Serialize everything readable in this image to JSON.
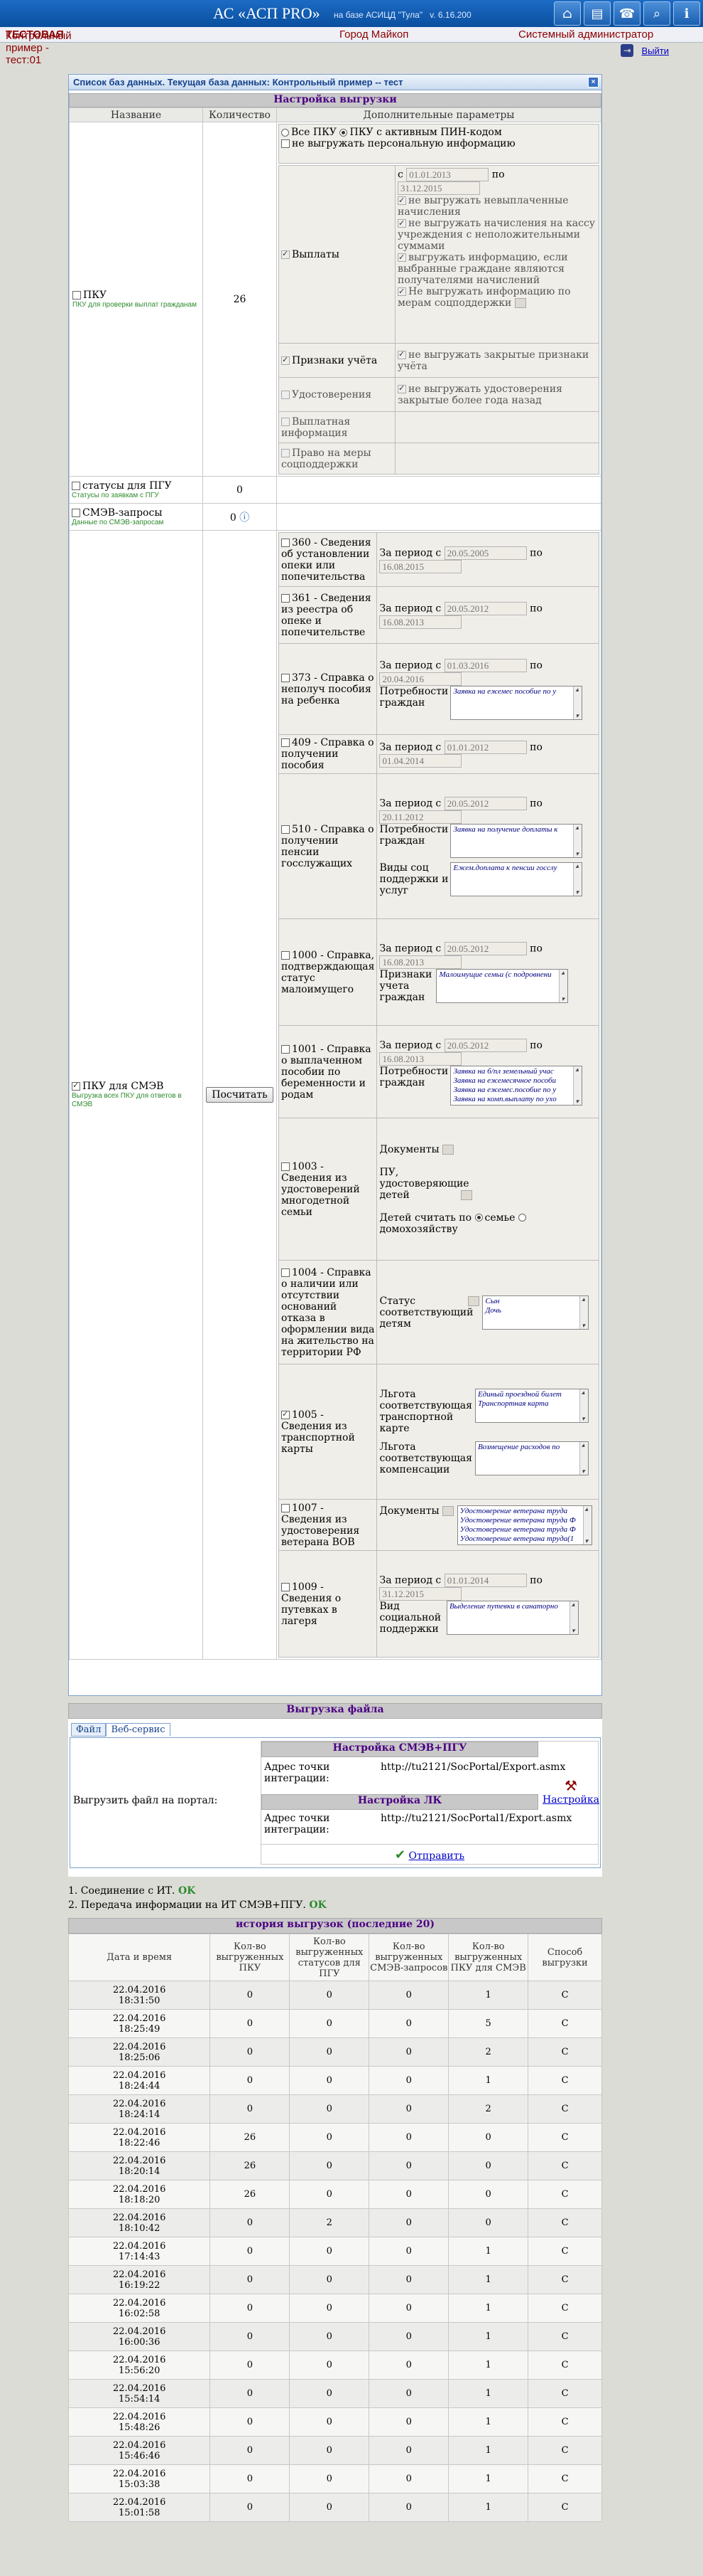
{
  "header": {
    "app_title": "АС «АСП PRO»",
    "base_label": "на базе АСИЦД \"Тула\"",
    "version": "v. 6.16.200",
    "test_label": "Контрольный пример - тест:01",
    "test_badge": "ТЕСТОВАЯ",
    "city": "Город Майкоп",
    "user": "Системный администратор",
    "exit": "Выйти",
    "icons": [
      "home-icon",
      "document-icon",
      "phone-icon",
      "search-icon",
      "info-icon"
    ]
  },
  "db_panel": {
    "title": "Список баз данных. Текущая база данных: Контрольный пример -- тест"
  },
  "export_settings": {
    "title": "Настройка выгрузки",
    "columns": [
      "Название",
      "Количество",
      "Дополнительные параметры"
    ],
    "pku": {
      "name": "ПКУ",
      "hint": "ПКУ для проверки выплат гражданам",
      "count": "26",
      "radio_all": "Все ПКУ",
      "radio_pin": "ПКУ с активным ПИН-кодом",
      "no_personal": "не выгружать персональную информацию",
      "payments": "Выплаты",
      "from": "с",
      "to": "по",
      "date_from": "01.01.2013",
      "date_to": "31.12.2015",
      "opt1": "не выгружать невыплаченные начисления",
      "opt2": "не выгружать начисления на кассу учреждения с неположительными суммами",
      "opt3": "выгружать информацию, если выбранные граждане являются получателями начислений",
      "opt4": "Не выгружать информацию по мерам соцподдержки",
      "signs": "Признаки учёта",
      "signs_opt": "не выгружать закрытые признаки учёта",
      "ids": "Удостоверения",
      "ids_opt": "не выгружать удостоверения закрытые более года назад",
      "paid_info": "Выплатная информация",
      "right_measures": "Право на меры соцподдержки"
    },
    "pgu": {
      "name": "статусы для ПГУ",
      "hint": "Статусы по заявкам с ПГУ",
      "count": "0"
    },
    "smev_req": {
      "name": "СМЭВ-запросы",
      "hint": "Данные по СМЭВ-запросам",
      "count": "0"
    },
    "smev": {
      "name": "ПКУ для СМЭВ",
      "hint": "Выгрузка всех ПКУ для ответов в СМЭВ",
      "button": "Посчитать",
      "period_prefix": "За период с",
      "to": "по",
      "need_label": "Потребности граждан",
      "measures_label": "Виды соц поддержки и услуг",
      "signs_label": "Признаки учета граждан",
      "documents_label": "Документы",
      "pu_label": "ПУ, удостоверяющие детей",
      "count_children": "Детей считать по",
      "by_family": "семье",
      "by_household": "домохозяйству",
      "status_children": "Статус соответствующий детям",
      "benefit_card": "Льгота соответствующая транспортной карте",
      "benefit_comp": "Льгота соответствующая компенсации",
      "rest_type": "Вид социальной поддержки",
      "requests": [
        {
          "code": "360",
          "label": "360 - Сведения об установлении опеки или попечительства",
          "d1": "20.05.2005",
          "d2": "16.08.2015"
        },
        {
          "code": "361",
          "label": "361 - Сведения из реестра об опеке и попечительстве",
          "d1": "20.05.2012",
          "d2": "16.08.2013"
        },
        {
          "code": "373",
          "label": "373 - Справка о неполуч пособия на ребенка",
          "d1": "01.03.2016",
          "d2": "20.04.2016",
          "list": [
            "Заявка на ежемес пособие по у"
          ]
        },
        {
          "code": "409",
          "label": "409 - Справка о получении пособия",
          "d1": "01.01.2012",
          "d2": "01.04.2014"
        },
        {
          "code": "510",
          "label": "510 - Справка о получении пенсии госслужащих",
          "d1": "20.05.2012",
          "d2": "20.11.2012",
          "list": [
            "Заявка на получение доплаты к"
          ],
          "list2": [
            "Ежем.доплата к пенсии госслу"
          ]
        },
        {
          "code": "1000",
          "label": "1000 - Справка, подтверждающая статус малоимущего",
          "d1": "20.05.2012",
          "d2": "16.08.2013",
          "list": [
            "Малоимущие семьи (с подровнени"
          ]
        },
        {
          "code": "1001",
          "label": "1001 - Справка о выплаченном пособии по беременности и родам",
          "d1": "20.05.2012",
          "d2": "16.08.2013",
          "list": [
            "Заявка на б/пл земельный учас",
            "Заявка на ежемесячное пособи",
            "Заявка на ежемес.пособие по у",
            "Заявка на комп.выплату по уxo"
          ]
        },
        {
          "code": "1003",
          "label": "1003 - Сведения из удостоверений многодетной семьи"
        },
        {
          "code": "1004",
          "label": "1004 - Справка о наличии или отсутствии оснований отказа в оформлении вида на жительство на территории РФ",
          "list": [
            "Сын",
            "Дочь"
          ]
        },
        {
          "code": "1005",
          "label": "1005 - Сведения из транспортной карты",
          "list": [
            "Единый проездной билет",
            "Транспортная карта"
          ],
          "list2": [
            "Возмещение расходов по"
          ]
        },
        {
          "code": "1007",
          "label": "1007 - Сведения из удостоверения ветерана ВОВ",
          "list": [
            "Удостоверение ветерана труда",
            "Удостоверение ветерана труда Ф",
            "Удостоверение ветерана труда Ф",
            "Удостоверение ветерана труда(1"
          ]
        },
        {
          "code": "1009",
          "label": "1009 - Сведения о путевках в лагеря",
          "d1": "01.01.2014",
          "d2": "31.12.2015",
          "list": [
            "Выделение путевки в санаторно"
          ]
        }
      ]
    }
  },
  "upload": {
    "title": "Выгрузка файла",
    "tabs": [
      "Файл",
      "Веб-сервис"
    ],
    "portal_label": "Выгрузить файл на портал:",
    "smev_title": "Настройка СМЭВ+ПГУ",
    "lk_title": "Настройка ЛК",
    "addr_label": "Адрес точки интеграции:",
    "addr_smev": "http://tu2121/SocPortal/Export.asmx",
    "addr_lk": "http://tu2121/SocPortal1/Export.asmx",
    "settings_link": "Настройка",
    "send": "Отправить"
  },
  "status_lines": [
    {
      "text": "1. Соединение с ИТ.",
      "ok": "OK"
    },
    {
      "text": "2. Передача информации на ИТ СМЭВ+ПГУ.",
      "ok": "OK"
    }
  ],
  "history": {
    "title": "история выгрузок (последние 20)",
    "headers": [
      "Дата и время",
      "Кол-во выгруженных ПКУ",
      "Кол-во выгруженных статусов для ПГУ",
      "Кол-во выгруженных СМЭВ-запросов",
      "Кол-во выгруженных ПКУ для СМЭВ",
      "Способ выгрузки"
    ],
    "rows": [
      [
        "22.04.2016\n18:31:50",
        "0",
        "0",
        "0",
        "1",
        "С"
      ],
      [
        "22.04.2016\n18:25:49",
        "0",
        "0",
        "0",
        "5",
        "С"
      ],
      [
        "22.04.2016\n18:25:06",
        "0",
        "0",
        "0",
        "2",
        "С"
      ],
      [
        "22.04.2016\n18:24:44",
        "0",
        "0",
        "0",
        "1",
        "С"
      ],
      [
        "22.04.2016\n18:24:14",
        "0",
        "0",
        "0",
        "2",
        "С"
      ],
      [
        "22.04.2016\n18:22:46",
        "26",
        "0",
        "0",
        "0",
        "С"
      ],
      [
        "22.04.2016\n18:20:14",
        "26",
        "0",
        "0",
        "0",
        "С"
      ],
      [
        "22.04.2016\n18:18:20",
        "26",
        "0",
        "0",
        "0",
        "С"
      ],
      [
        "22.04.2016\n18:10:42",
        "0",
        "2",
        "0",
        "0",
        "С"
      ],
      [
        "22.04.2016\n17:14:43",
        "0",
        "0",
        "0",
        "1",
        "С"
      ],
      [
        "22.04.2016\n16:19:22",
        "0",
        "0",
        "0",
        "1",
        "С"
      ],
      [
        "22.04.2016\n16:02:58",
        "0",
        "0",
        "0",
        "1",
        "С"
      ],
      [
        "22.04.2016\n16:00:36",
        "0",
        "0",
        "0",
        "1",
        "С"
      ],
      [
        "22.04.2016\n15:56:20",
        "0",
        "0",
        "0",
        "1",
        "С"
      ],
      [
        "22.04.2016\n15:54:14",
        "0",
        "0",
        "0",
        "1",
        "С"
      ],
      [
        "22.04.2016\n15:48:26",
        "0",
        "0",
        "0",
        "1",
        "С"
      ],
      [
        "22.04.2016\n15:46:46",
        "0",
        "0",
        "0",
        "1",
        "С"
      ],
      [
        "22.04.2016\n15:03:38",
        "0",
        "0",
        "0",
        "1",
        "С"
      ],
      [
        "22.04.2016\n15:01:58",
        "0",
        "0",
        "0",
        "1",
        "С"
      ]
    ]
  }
}
